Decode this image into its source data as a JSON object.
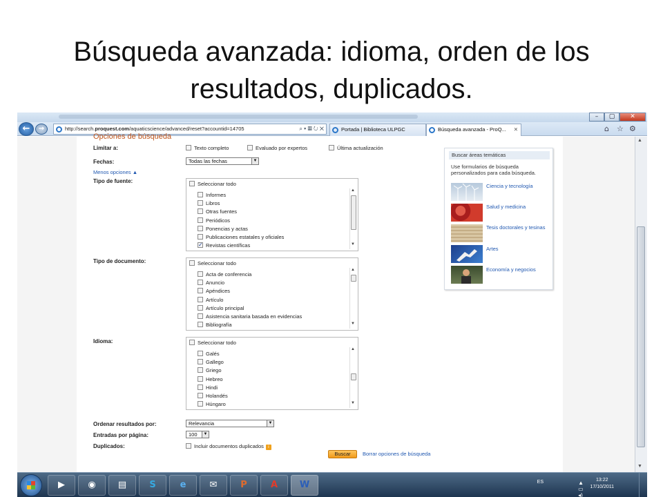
{
  "slide": {
    "title_line1": "Búsqueda avanzada: idioma, orden de los",
    "title_line2": "resultados, duplicados."
  },
  "browser": {
    "url_prefix": "http://search.",
    "url_domain": "proquest.com",
    "url_rest": "/aquaticscience/advanced/reset?accountid=14705",
    "tabs": [
      {
        "label": "Portada | Biblioteca ULPGC",
        "active": false
      },
      {
        "label": "Búsqueda avanzada - ProQ...",
        "active": true
      }
    ],
    "window_buttons": [
      "–",
      "▢",
      "✕"
    ]
  },
  "form": {
    "section_title": "Opciones de búsqueda",
    "limit_label": "Limitar a:",
    "limit_options": [
      {
        "label": "Texto completo",
        "checked": false
      },
      {
        "label": "Evaluado por expertos",
        "checked": false
      },
      {
        "label": "Última actualización",
        "checked": false
      }
    ],
    "dates_label": "Fechas:",
    "dates_value": "Todas las fechas",
    "fewer_options": "Menos opciones ▲",
    "source_type": {
      "label": "Tipo de fuente:",
      "select_all": "Seleccionar todo",
      "items": [
        {
          "label": "Informes",
          "checked": false
        },
        {
          "label": "Libros",
          "checked": false
        },
        {
          "label": "Otras fuentes",
          "checked": false
        },
        {
          "label": "Periódicos",
          "checked": false
        },
        {
          "label": "Ponencias y actas",
          "checked": false
        },
        {
          "label": "Publicaciones estatales y oficiales",
          "checked": false
        },
        {
          "label": "Revistas científicas",
          "checked": true
        }
      ]
    },
    "doc_type": {
      "label": "Tipo de documento:",
      "select_all": "Seleccionar todo",
      "items": [
        {
          "label": "Acta de conferencia",
          "checked": false
        },
        {
          "label": "Anuncio",
          "checked": false
        },
        {
          "label": "Apéndices",
          "checked": false
        },
        {
          "label": "Artículo",
          "checked": false
        },
        {
          "label": "Artículo principal",
          "checked": false
        },
        {
          "label": "Asistencia sanitaria basada en evidencias",
          "checked": false
        },
        {
          "label": "Bibliografía",
          "checked": false
        }
      ]
    },
    "language": {
      "label": "Idioma:",
      "select_all": "Seleccionar todo",
      "items": [
        {
          "label": "Galés",
          "checked": false
        },
        {
          "label": "Gallego",
          "checked": false
        },
        {
          "label": "Griego",
          "checked": false
        },
        {
          "label": "Hebreo",
          "checked": false
        },
        {
          "label": "Hindi",
          "checked": false
        },
        {
          "label": "Holandés",
          "checked": false
        },
        {
          "label": "Húngaro",
          "checked": false
        }
      ]
    },
    "sort_label": "Ordenar resultados por:",
    "sort_value": "Relevancia",
    "per_page_label": "Entradas por página:",
    "per_page_value": "100",
    "duplicates_label": "Duplicados:",
    "duplicates_option": "Incluir documentos duplicados",
    "search_button": "Buscar",
    "clear_link": "Borrar opciones de búsqueda"
  },
  "side_panel": {
    "title": "Buscar áreas temáticas",
    "description": "Use formularios de búsqueda personalizados para cada búsqueda.",
    "areas": [
      {
        "label": "Ciencia y tecnología",
        "icon": "wind-turbines-thumbnail"
      },
      {
        "label": "Salud y medicina",
        "icon": "blood-cells-thumbnail"
      },
      {
        "label": "Tesis doctorales y tesinas",
        "icon": "old-manuscript-thumbnail"
      },
      {
        "label": "Artes",
        "icon": "hand-painting-thumbnail"
      },
      {
        "label": "Economía y negocios",
        "icon": "business-meeting-thumbnail"
      }
    ]
  },
  "taskbar": {
    "apps": [
      "media-player-icon",
      "firefox-icon",
      "explorer-icon",
      "skype-icon",
      "ie-icon",
      "outlook-icon",
      "powerpoint-icon",
      "acrobat-icon",
      "word-icon"
    ],
    "lang": "ES",
    "time": "13:22",
    "date": "17/10/2011"
  }
}
